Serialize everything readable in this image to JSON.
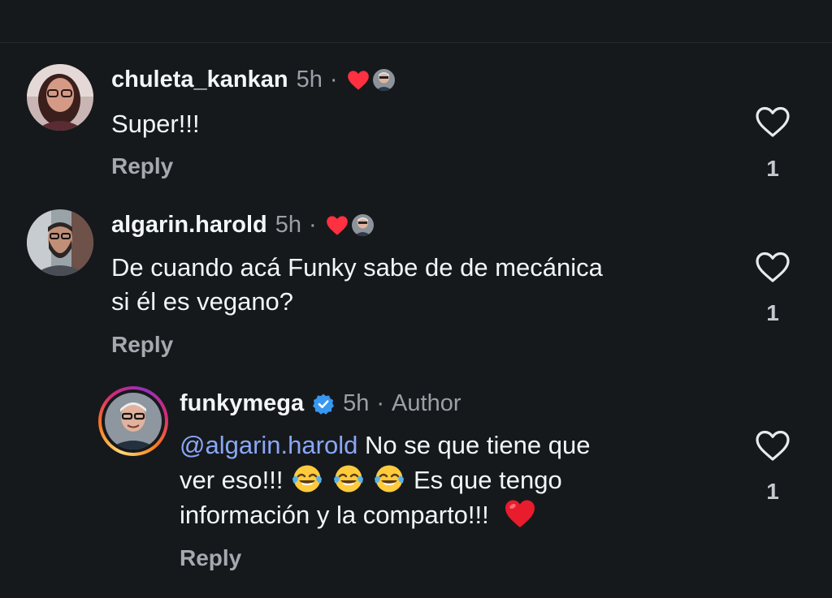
{
  "comments": [
    {
      "username": "chuleta_kankan",
      "time": "5h",
      "separator": "·",
      "text": "Super!!!",
      "reply_label": "Reply",
      "like_count": "1"
    },
    {
      "username": "algarin.harold",
      "time": "5h",
      "separator": "·",
      "text_line1": "De cuando acá Funky sabe de de mecánica",
      "text_line2": "si él es vegano?",
      "reply_label": "Reply",
      "like_count": "1"
    }
  ],
  "reply": {
    "username": "funkymega",
    "time": "5h",
    "separator": "·",
    "author_label": "Author",
    "mention": "@algarin.harold",
    "text_part1": "No se que tiene que",
    "text_part2": "ver eso!!!",
    "text_part3": "Es que tengo",
    "text_part4": "información y la comparto!!!",
    "emoji_names": [
      "face-with-tears-of-joy-icon",
      "face-with-tears-of-joy-icon",
      "face-with-tears-of-joy-icon",
      "red-heart-icon"
    ],
    "reply_label": "Reply",
    "like_count": "1"
  },
  "colors": {
    "background": "#16191c",
    "mention": "#8aa7f7",
    "heart_red": "#ff3040",
    "verified_blue": "#3897f0"
  }
}
